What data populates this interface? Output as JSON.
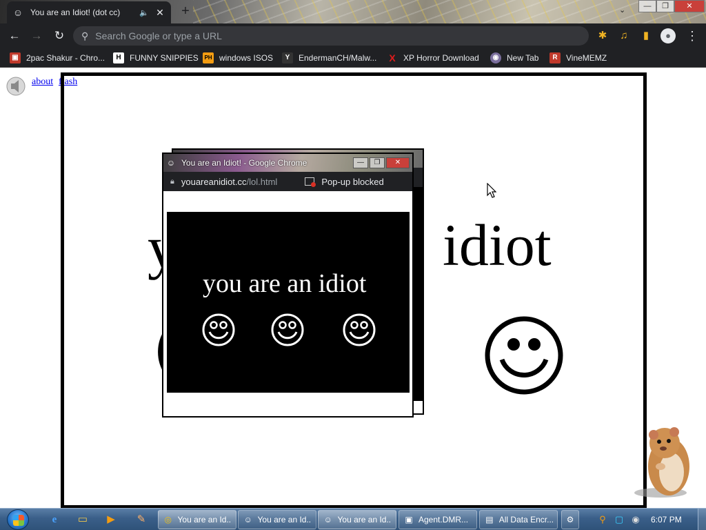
{
  "browser": {
    "tab": {
      "title": "You are an Idiot! (dot cc)",
      "favicon": "☺",
      "audio_icon": "🔈",
      "close": "✕"
    },
    "new_tab": "+",
    "window_controls": {
      "minimize": "—",
      "maximize": "❐",
      "close": "✕"
    },
    "tab_search": "⌄",
    "toolbar": {
      "back": "←",
      "forward": "→",
      "reload": "↻",
      "omnibox_placeholder": "Search Google or type a URL",
      "search_icon": "⚲",
      "extensions_icon": "✱",
      "media_icon": "♫",
      "sidepanel_icon": "▮",
      "profile_icon": "●",
      "menu_icon": "⋮"
    },
    "bookmarks": [
      {
        "label": "2pac Shakur - Chro...",
        "icon": "▣",
        "color": "#c0392b"
      },
      {
        "label": "FUNNY SNIPPIES",
        "icon": "H",
        "color": "#444444"
      },
      {
        "label": "windows ISOS",
        "icon": "PH",
        "color": "#f39c12"
      },
      {
        "label": "EndermanCH/Malw...",
        "icon": "Y",
        "color": "#333333"
      },
      {
        "label": "XP Horror Download",
        "icon": "X",
        "color": "#e21c1c"
      },
      {
        "label": "New Tab",
        "icon": "◉",
        "color": "#7a6e9c"
      },
      {
        "label": "VineMEMZ",
        "icon": "R",
        "color": "#c0392b"
      }
    ]
  },
  "page": {
    "links": {
      "about": "about",
      "flash": "flash"
    },
    "big_text_left": "y",
    "big_text_right": "idiot"
  },
  "popup": {
    "title": "You are an Idiot! - Google Chrome",
    "favicon": "☺",
    "controls": {
      "minimize": "—",
      "maximize": "❐",
      "close": "✕"
    },
    "url_host": "youareanidiot.cc",
    "url_path": "/lol.html",
    "popup_blocked": "Pop-up blocked",
    "message": "you are an idiot"
  },
  "taskbar": {
    "pinned": [
      {
        "name": "ie",
        "icon": "e"
      },
      {
        "name": "explorer",
        "icon": "▭"
      },
      {
        "name": "media-player",
        "icon": "▶"
      },
      {
        "name": "paint",
        "icon": "✎"
      }
    ],
    "tasks": [
      {
        "label": "You are an Id...",
        "icon": "◎",
        "active": true
      },
      {
        "label": "You are an Id...",
        "icon": "☺",
        "active": false
      },
      {
        "label": "You are an Id...",
        "icon": "☺",
        "active": true
      },
      {
        "label": "Agent.DMR...",
        "icon": "▣",
        "active": false
      },
      {
        "label": "All Data Encr...",
        "icon": "▤",
        "active": false
      }
    ],
    "clock": "6:07 PM"
  },
  "colors": {
    "chrome_dark": "#202124",
    "link": "#0000ee",
    "taskbar": "#3a5f89"
  }
}
